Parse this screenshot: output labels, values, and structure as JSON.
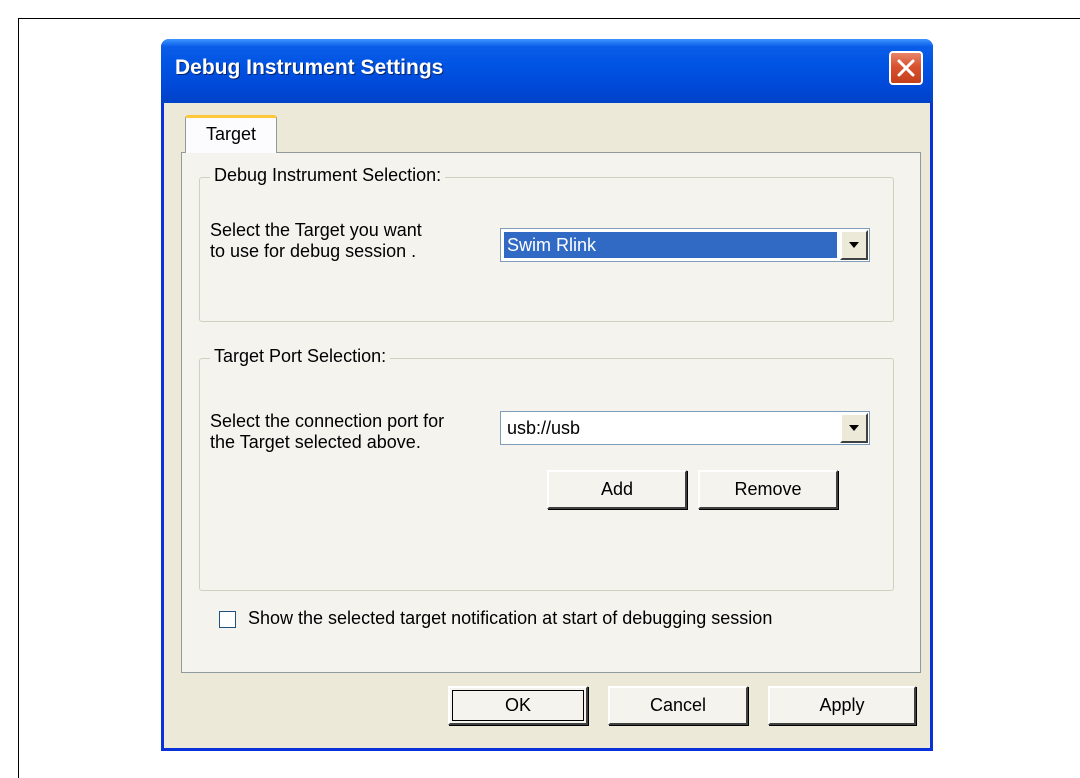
{
  "dialog": {
    "title": "Debug Instrument Settings",
    "tabs": [
      {
        "label": "Target",
        "active": true
      }
    ],
    "instrument_group": {
      "title": "Debug Instrument Selection:",
      "description_line1": "Select the Target you want",
      "description_line2": "to use for debug session .",
      "selected_value": "Swim Rlink"
    },
    "port_group": {
      "title": "Target Port Selection:",
      "description_line1": "Select the connection port for",
      "description_line2": "the Target selected above.",
      "selected_value": "usb://usb",
      "add_label": "Add",
      "remove_label": "Remove"
    },
    "notification_checkbox": {
      "label": "Show the selected target notification at start of debugging session",
      "checked": false
    },
    "buttons": {
      "ok": "OK",
      "cancel": "Cancel",
      "apply": "Apply"
    }
  },
  "colors": {
    "titlebar": "#0054e3",
    "dialog_bg": "#ece9d8",
    "selection": "#316ac5",
    "close_button": "#d8522f"
  }
}
